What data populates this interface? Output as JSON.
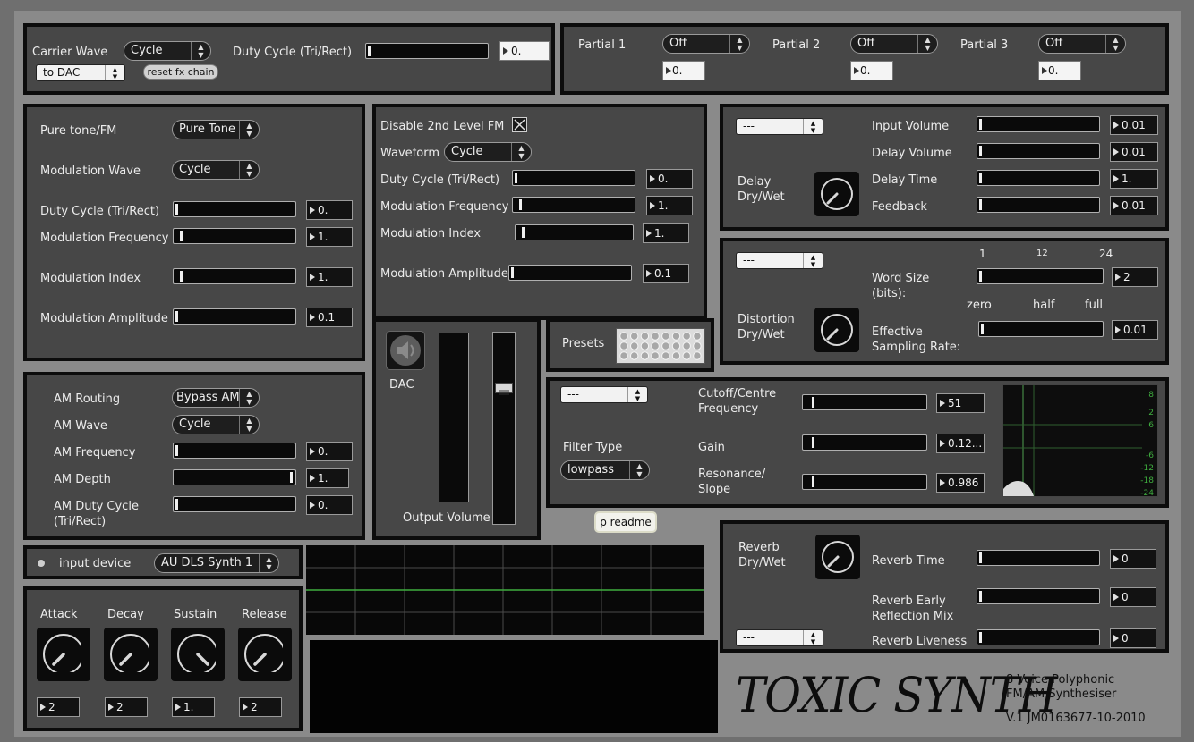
{
  "carrier": {
    "carrier_wave_label": "Carrier Wave",
    "carrier_wave_value": "Cycle",
    "output_value": "to DAC",
    "reset_label": "reset fx chain",
    "duty_label": "Duty Cycle (Tri/Rect)",
    "duty_value": "0.",
    "duty_level": 0
  },
  "partials": [
    {
      "label": "Partial 1",
      "state": "Off",
      "value": "0."
    },
    {
      "label": "Partial 2",
      "state": "Off",
      "value": "0."
    },
    {
      "label": "Partial 3",
      "state": "Off",
      "value": "0."
    }
  ],
  "fm1": {
    "pure_label": "Pure tone/FM",
    "pure_value": "Pure Tone",
    "mod_wave_label": "Modulation Wave",
    "mod_wave_value": "Cycle",
    "duty_label": "Duty Cycle (Tri/Rect)",
    "duty_value": "0.",
    "freq_label": "Modulation Frequency",
    "freq_value": "1.",
    "index_label": "Modulation Index",
    "index_value": "1.",
    "amp_label": "Modulation Amplitude",
    "amp_value": "0.1"
  },
  "fm2": {
    "disable_label": "Disable 2nd Level FM",
    "disable_checked": true,
    "waveform_label": "Waveform",
    "waveform_value": "Cycle",
    "duty_label": "Duty Cycle (Tri/Rect)",
    "duty_value": "0.",
    "freq_label": "Modulation Frequency",
    "freq_value": "1.",
    "index_label": "Modulation Index",
    "index_value": "1.",
    "amp_label": "Modulation Amplitude",
    "amp_value": "0.1"
  },
  "delay": {
    "preset_value": "---",
    "drywet_label_1": "Delay",
    "drywet_label_2": "Dry/Wet",
    "input_label": "Input Volume",
    "input_value": "0.01",
    "volume_label": "Delay Volume",
    "volume_value": "0.01",
    "time_label": "Delay Time",
    "time_value": "1.",
    "feedback_label": "Feedback",
    "feedback_value": "0.01"
  },
  "distortion": {
    "preset_value": "---",
    "drywet_label_1": "Distortion",
    "drywet_label_2": "Dry/Wet",
    "tick_1": "1",
    "tick_12": "12",
    "tick_24": "24",
    "word_label_1": "Word Size",
    "word_label_2": "(bits):",
    "word_value": "2",
    "rate_zero": "zero",
    "rate_half": "half",
    "rate_full": "full",
    "rate_label_1": "Effective",
    "rate_label_2": "Sampling Rate:",
    "rate_value": "0.01"
  },
  "am": {
    "routing_label": "AM Routing",
    "routing_value": "Bypass AM",
    "wave_label": "AM Wave",
    "wave_value": "Cycle",
    "freq_label": "AM Frequency",
    "freq_value": "0.",
    "depth_label": "AM Depth",
    "depth_value": "1.",
    "duty_label_1": "AM Duty Cycle",
    "duty_label_2": "(Tri/Rect)",
    "duty_value": "0."
  },
  "dac": {
    "label": "DAC",
    "output_label": "Output Volume",
    "volume_level": 0.72
  },
  "presets": {
    "label": "Presets"
  },
  "filter": {
    "preset_value": "---",
    "type_label": "Filter Type",
    "type_value": "lowpass",
    "cutoff_label_1": "Cutoff/Centre",
    "cutoff_label_2": "Frequency",
    "cutoff_value": "51",
    "gain_label": "Gain",
    "gain_value": "0.12...",
    "res_label_1": "Resonance/",
    "res_label_2": "Slope",
    "res_value": "0.986",
    "db_ticks": [
      "8",
      "2",
      "6",
      "-6",
      "-12",
      "-18",
      "-24"
    ]
  },
  "readme": {
    "label": "p readme"
  },
  "input": {
    "label": "input device",
    "value": "AU DLS Synth 1"
  },
  "envelope": {
    "attack_label": "Attack",
    "attack_value": "2",
    "decay_label": "Decay",
    "decay_value": "2",
    "sustain_label": "Sustain",
    "sustain_value": "1.",
    "release_label": "Release",
    "release_value": "2"
  },
  "reverb": {
    "drywet_label_1": "Reverb",
    "drywet_label_2": "Dry/Wet",
    "preset_value": "---",
    "time_label": "Reverb Time",
    "time_value": "0",
    "early_label_1": "Reverb Early",
    "early_label_2": "Reflection Mix",
    "early_value": "0",
    "liveness_label": "Reverb Liveness",
    "liveness_value": "0"
  },
  "branding": {
    "logo_text": "TOXIC SYNTH",
    "subtitle_1": "8 Voice Polyphonic",
    "subtitle_2": "FM/AM Synthesiser",
    "version": "V.1 JM0163677-10-2010"
  },
  "colors": {
    "panel": "#474747",
    "border": "#0c0c0c",
    "background": "#8a8a8a",
    "scope_trace": "#3fae3f"
  }
}
